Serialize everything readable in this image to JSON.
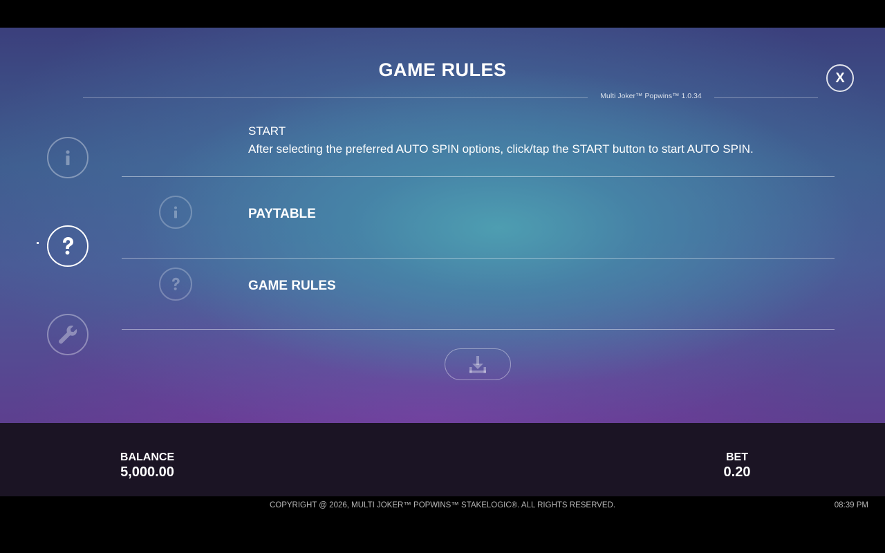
{
  "header": {
    "title": "GAME RULES",
    "version": "Multi Joker™ Popwins™ 1.0.34",
    "close_label": "X"
  },
  "sidebar": {
    "items": [
      {
        "name": "info",
        "icon": "info-icon",
        "active": false
      },
      {
        "name": "help",
        "icon": "question-icon",
        "active": true
      },
      {
        "name": "settings",
        "icon": "wrench-icon",
        "active": false
      }
    ]
  },
  "content": {
    "start_heading": "START",
    "start_text": "After selecting the preferred AUTO SPIN options, click/tap the START button to start AUTO SPIN.",
    "rows": [
      {
        "label": "PAYTABLE",
        "icon": "info-icon"
      },
      {
        "label": "GAME RULES",
        "icon": "question-icon"
      }
    ],
    "download_icon": "download-icon"
  },
  "status": {
    "balance_label": "BALANCE",
    "balance_value": "5,000.00",
    "bet_label": "BET",
    "bet_value": "0.20"
  },
  "footer": {
    "copyright": "COPYRIGHT @ 2026, MULTI JOKER™ POPWINS™ STAKELOGIC®. ALL RIGHTS RESERVED.",
    "time": "08:39 PM"
  },
  "colors": {
    "background_top": "#3b3f7c",
    "background_teal": "#4ea0b2",
    "background_purple": "#5d3f8f",
    "bottom_bar": "#1b1424"
  }
}
